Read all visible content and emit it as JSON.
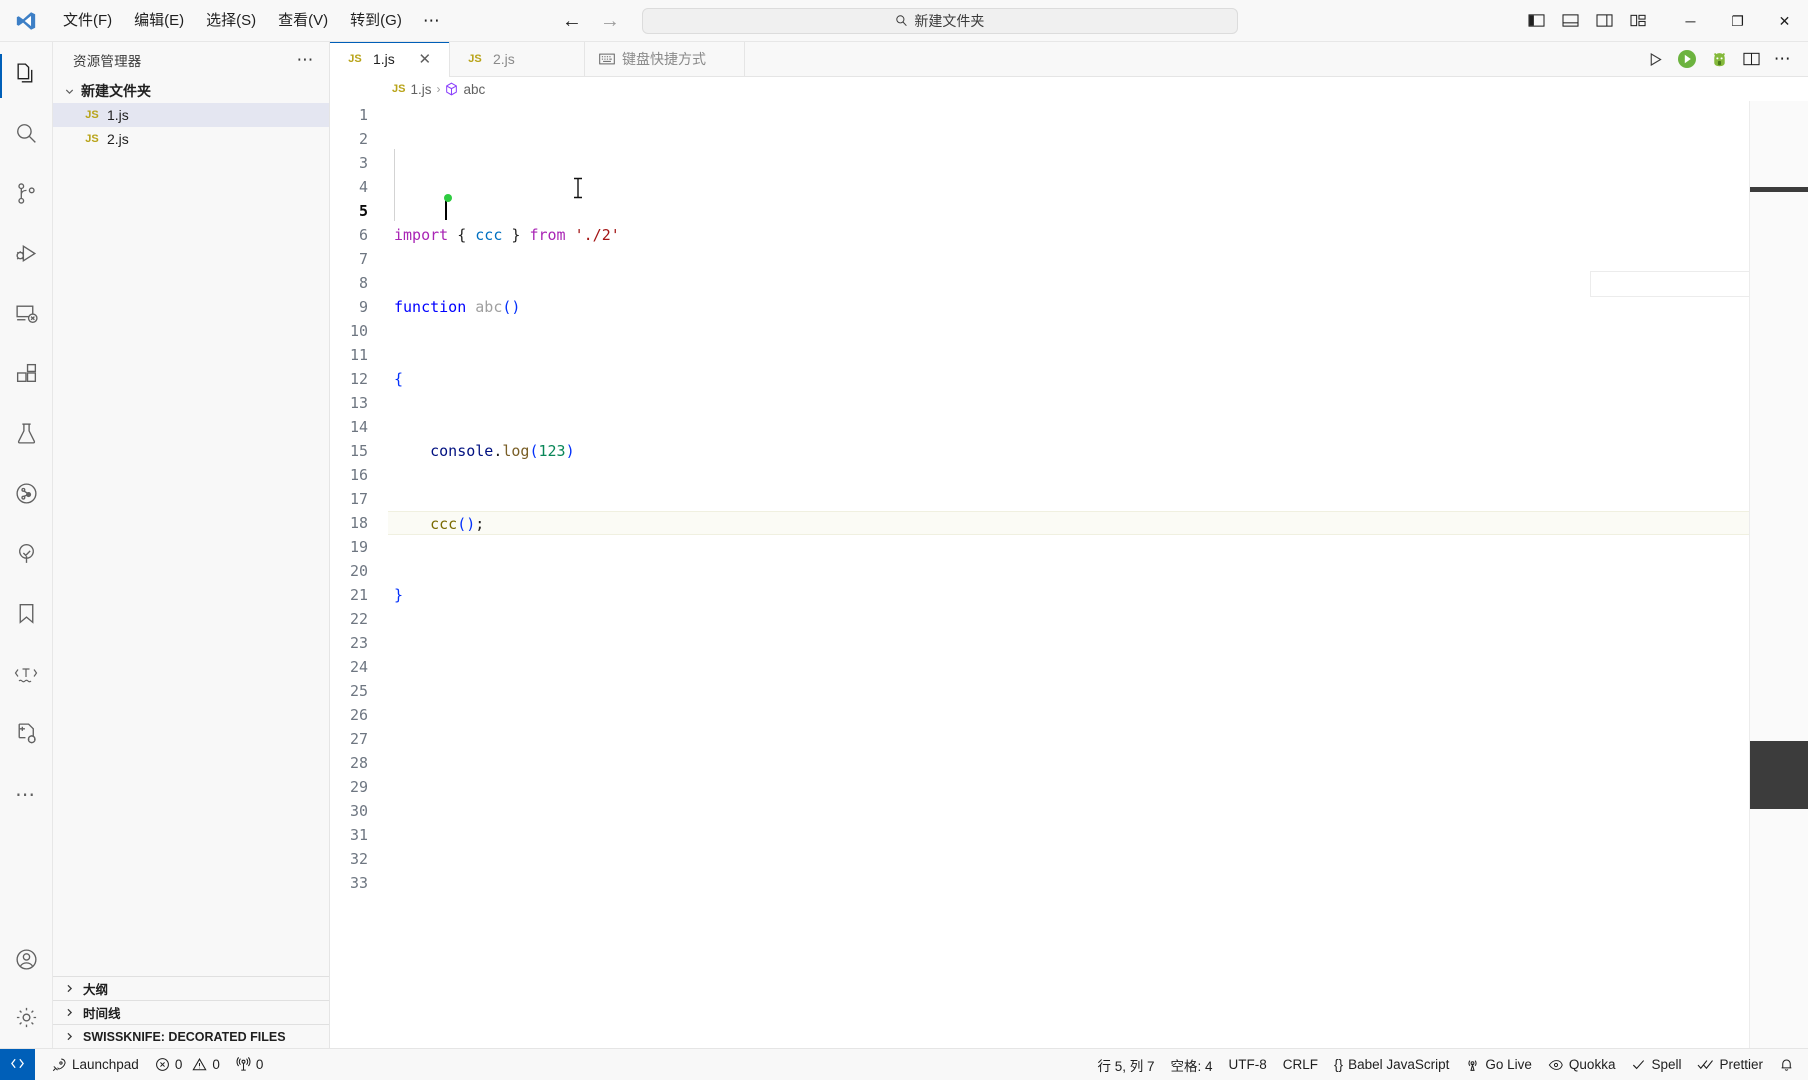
{
  "titlebar": {
    "logo_icon": "vscode-logo-icon",
    "menus": [
      {
        "label": "文件(F)"
      },
      {
        "label": "编辑(E)"
      },
      {
        "label": "选择(S)"
      },
      {
        "label": "查看(V)"
      },
      {
        "label": "转到(G)"
      }
    ],
    "more_label": "⋯",
    "nav_back_icon": "arrow-left-icon",
    "nav_forward_icon": "arrow-right-icon",
    "command_center": {
      "search_icon": "search-icon",
      "text": "新建文件夹"
    },
    "layout_buttons": [
      {
        "name": "toggle-primary-sidebar",
        "icon": "layout-sidebar-left-icon"
      },
      {
        "name": "toggle-panel",
        "icon": "layout-panel-icon"
      },
      {
        "name": "toggle-secondary-sidebar",
        "icon": "layout-sidebar-right-icon"
      },
      {
        "name": "customize-layout",
        "icon": "layout-customize-icon"
      }
    ],
    "window_controls": {
      "minimize": "─",
      "maximize": "❐",
      "close": "✕"
    }
  },
  "activitybar": {
    "items": [
      {
        "name": "explorer",
        "icon": "files-icon",
        "active": true
      },
      {
        "name": "search",
        "icon": "search-icon",
        "active": false
      },
      {
        "name": "source-control",
        "icon": "source-control-icon",
        "active": false
      },
      {
        "name": "run-and-debug",
        "icon": "debug-icon",
        "active": false
      },
      {
        "name": "remote-explorer",
        "icon": "remote-explorer-icon",
        "active": false
      },
      {
        "name": "extensions",
        "icon": "extensions-icon",
        "active": false
      },
      {
        "name": "testing",
        "icon": "beaker-icon",
        "active": false
      },
      {
        "name": "quokka",
        "icon": "quokka-circle-icon",
        "active": false
      },
      {
        "name": "project-manager",
        "icon": "tree-check-icon",
        "active": false
      },
      {
        "name": "bookmarks",
        "icon": "bookmark-icon",
        "active": false
      },
      {
        "name": "spell-checker",
        "icon": "text-marker-icon",
        "active": false
      },
      {
        "name": "file-utils",
        "icon": "file-gear-icon",
        "active": false
      },
      {
        "name": "more-views",
        "icon": "ellipsis-icon",
        "active": false
      }
    ],
    "bottom": [
      {
        "name": "accounts",
        "icon": "account-icon"
      },
      {
        "name": "settings",
        "icon": "gear-icon"
      }
    ]
  },
  "sidebar": {
    "title": "资源管理器",
    "actions_icon": "ellipsis-icon",
    "tree": {
      "folder": {
        "label": "新建文件夹",
        "expanded": true,
        "twisty": "⌄"
      },
      "files": [
        {
          "label": "1.js",
          "badge": "JS",
          "selected": true
        },
        {
          "label": "2.js",
          "badge": "JS",
          "selected": false
        }
      ]
    },
    "panels": [
      {
        "label": "大纲",
        "twisty": "›"
      },
      {
        "label": "时间线",
        "twisty": "›"
      },
      {
        "label": "SWISSKNIFE: DECORATED FILES",
        "twisty": "›"
      }
    ]
  },
  "editor": {
    "tabs": [
      {
        "label": "1.js",
        "badge": "JS",
        "active": true,
        "close_icon": "close-icon",
        "has_close": true
      },
      {
        "label": "2.js",
        "badge": "JS",
        "active": false,
        "has_close": false
      },
      {
        "label": "键盘快捷方式",
        "icon": "keyboard-icon",
        "active": false,
        "has_close": false
      }
    ],
    "toolbar": [
      {
        "name": "run-python-file",
        "icon": "play-outline-icon"
      },
      {
        "name": "run-code",
        "icon": "play-circle-green-icon"
      },
      {
        "name": "quokka-run",
        "icon": "quokka-green-icon"
      },
      {
        "name": "split-editor-right",
        "icon": "split-editor-icon"
      },
      {
        "name": "more-actions",
        "icon": "ellipsis-icon"
      }
    ],
    "breadcrumb": [
      {
        "label": "1.js",
        "badge": "JS"
      },
      {
        "label": "abc",
        "icon": "symbol-cube-icon"
      }
    ],
    "line_numbers": [
      1,
      2,
      3,
      4,
      5,
      6,
      7,
      8,
      9,
      10,
      11,
      12,
      13,
      14,
      15,
      16,
      17,
      18,
      19,
      20,
      21,
      22,
      23,
      24,
      25,
      26,
      27,
      28,
      29,
      30,
      31,
      32,
      33
    ],
    "current_line": 5,
    "code_lines": [
      {
        "n": 1,
        "text": "import { ccc } from './2'"
      },
      {
        "n": 2,
        "text": "function abc()"
      },
      {
        "n": 3,
        "text": "{"
      },
      {
        "n": 4,
        "text": "    console.log(123)"
      },
      {
        "n": 5,
        "text": "    ccc();"
      },
      {
        "n": 6,
        "text": "}"
      }
    ]
  },
  "statusbar": {
    "remote_icon": "remote-indicator-icon",
    "left": [
      {
        "name": "launchpad",
        "icon": "rocket-icon",
        "label": "Launchpad"
      },
      {
        "name": "problems",
        "icon": "error-warning-icon",
        "label": "0 ⚠ 0"
      },
      {
        "name": "ports",
        "icon": "radio-tower-icon",
        "label": "0"
      }
    ],
    "errors": "0",
    "warnings": "0",
    "ports": "0",
    "right": [
      {
        "name": "editor-position",
        "label": "行 5, 列 7"
      },
      {
        "name": "editor-indentation",
        "label": "空格: 4"
      },
      {
        "name": "editor-encoding",
        "label": "UTF-8"
      },
      {
        "name": "editor-eol",
        "label": "CRLF"
      },
      {
        "name": "editor-language",
        "label": "Babel JavaScript",
        "prefix": "{}"
      },
      {
        "name": "go-live",
        "label": "Go Live",
        "icon": "broadcast-icon"
      },
      {
        "name": "quokka",
        "label": "Quokka",
        "icon": "quokka-eye-icon"
      },
      {
        "name": "spell",
        "label": "Spell",
        "icon": "check-icon"
      },
      {
        "name": "prettier",
        "label": "Prettier",
        "icon": "prettier-check-icon"
      },
      {
        "name": "notifications",
        "label": "",
        "icon": "bell-icon"
      }
    ]
  },
  "colors": {
    "accent": "#005fb8",
    "selection": "#e4e6f1",
    "quokka_green": "#2ecc40",
    "js_badge": "#b8a318"
  }
}
